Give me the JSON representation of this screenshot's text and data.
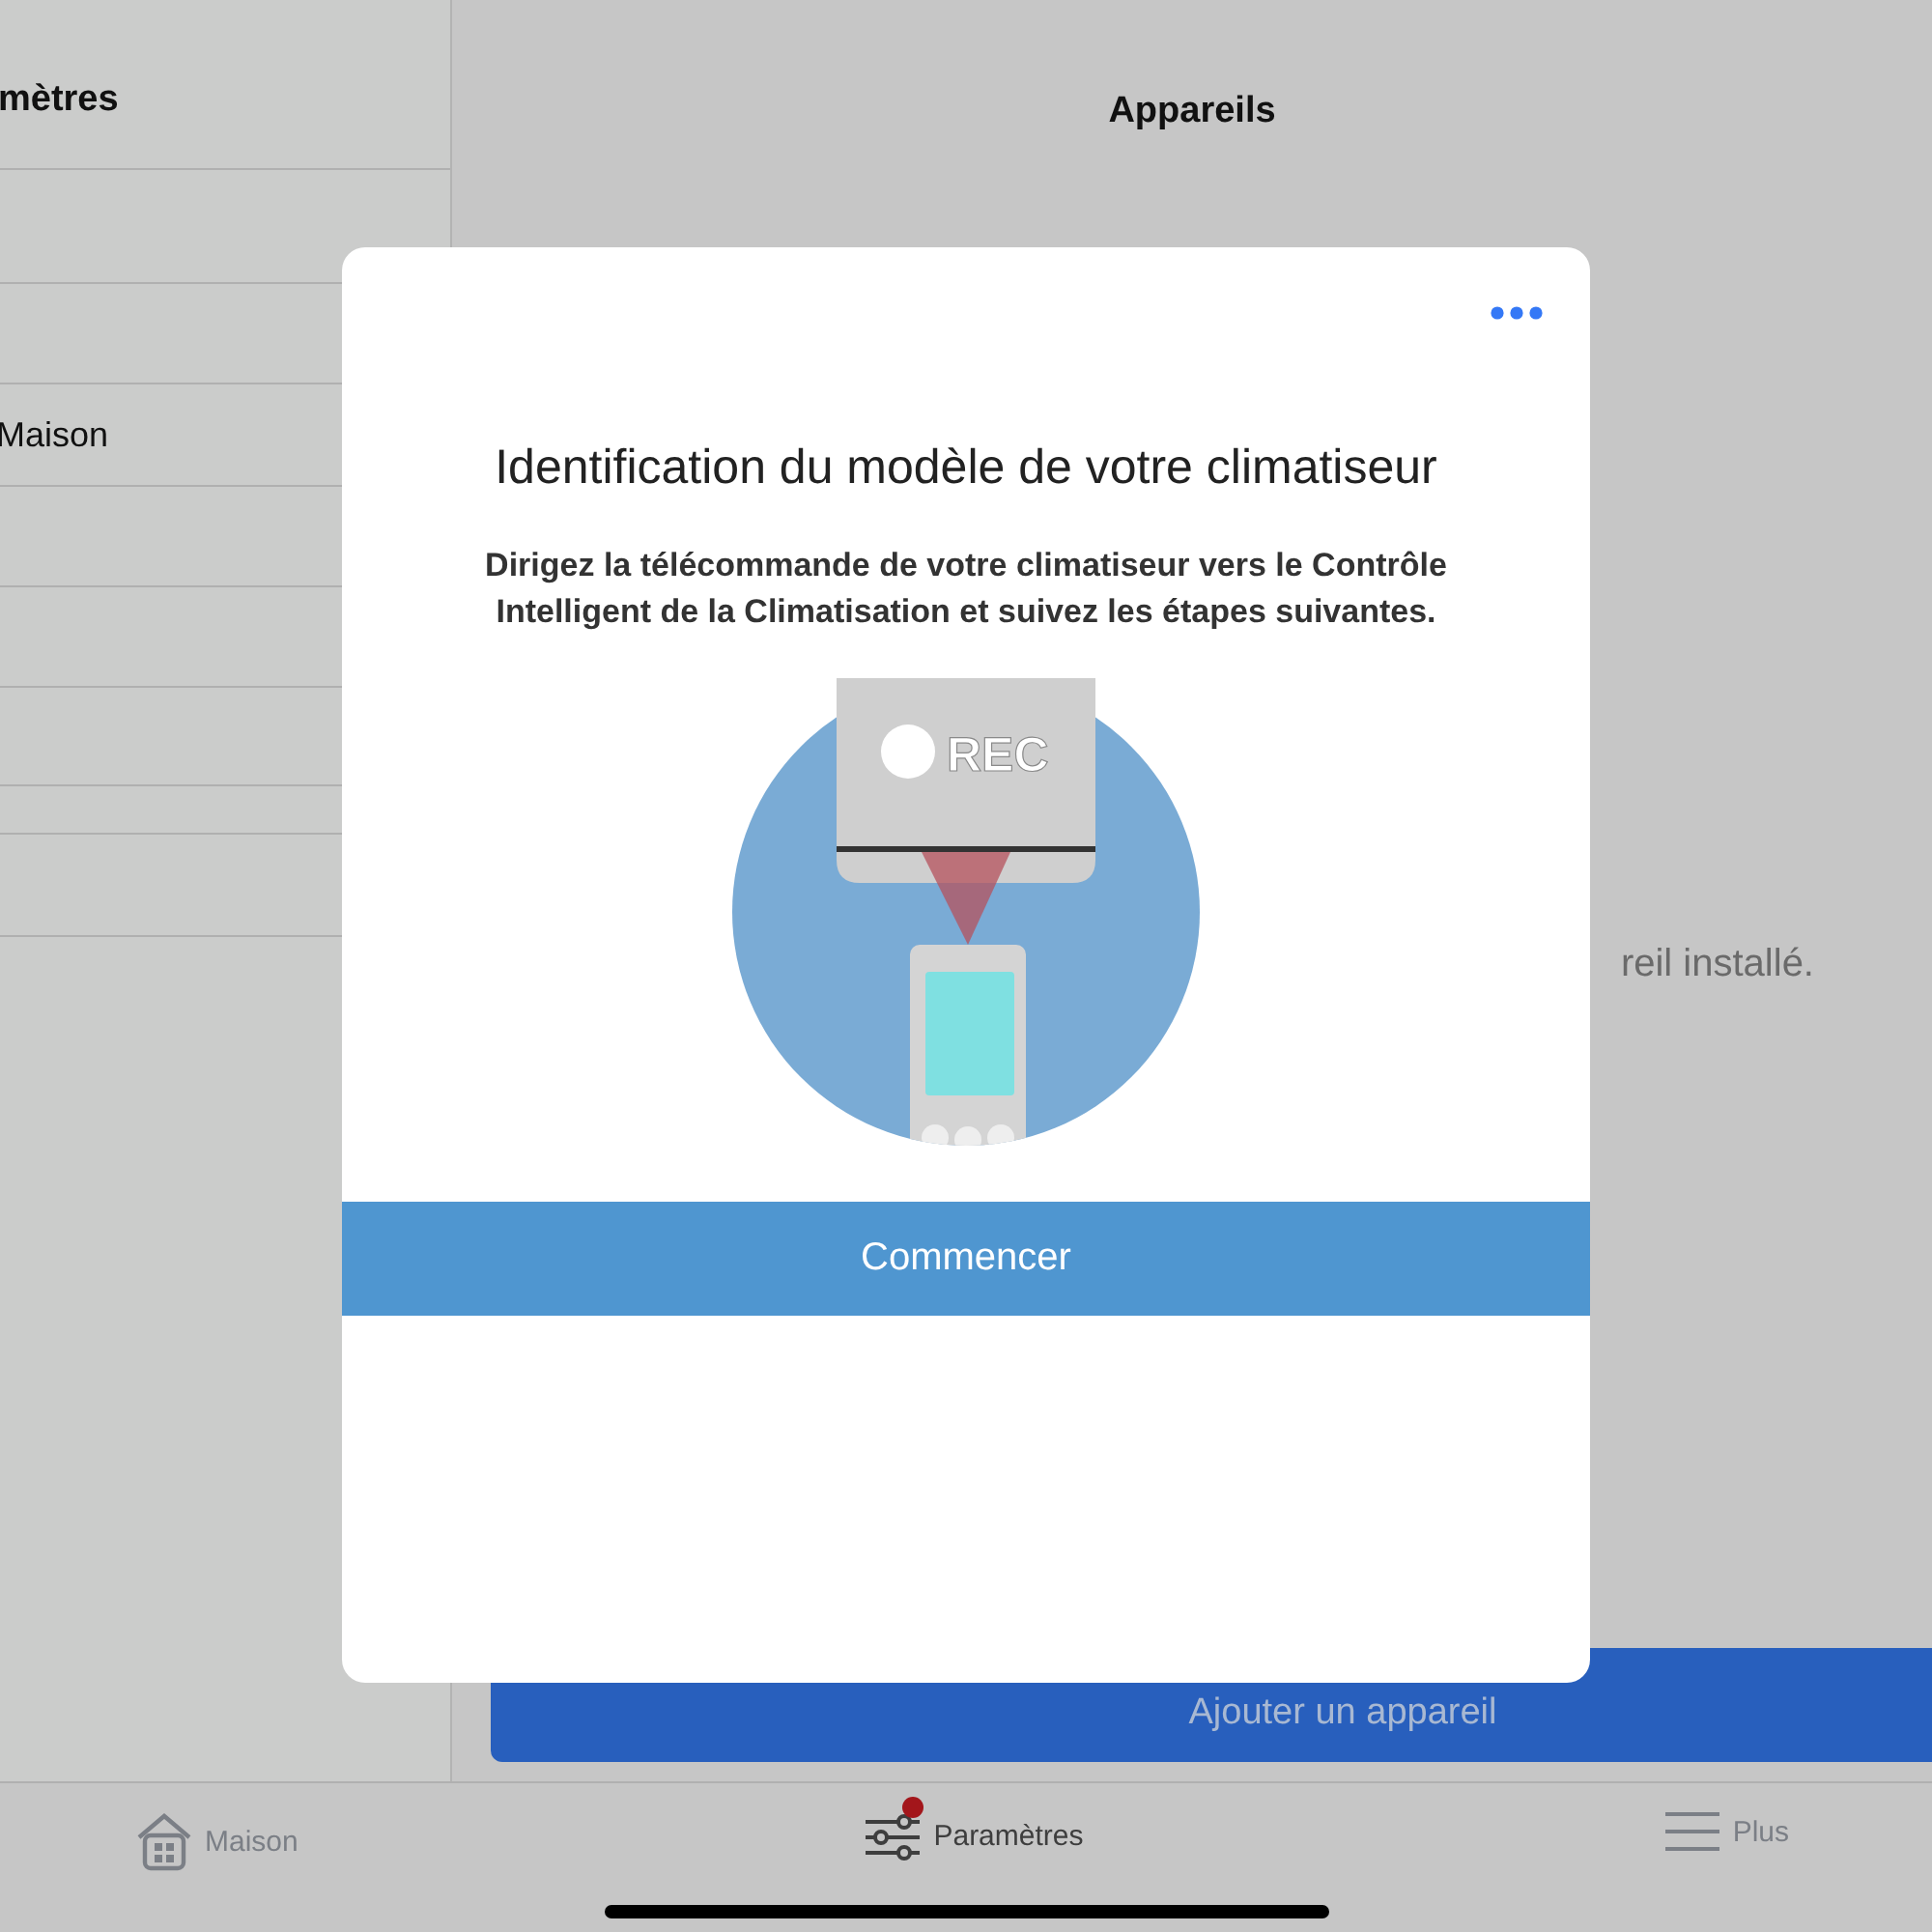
{
  "left_panel": {
    "title": "mètres",
    "items": [
      {
        "label": "Maison"
      }
    ]
  },
  "main_panel": {
    "title": "Appareils",
    "empty_message": "reil installé.",
    "add_button": "Ajouter un appareil"
  },
  "dialog": {
    "title": "Identification du modèle de votre climatiseur",
    "message": "Dirigez la télécommande de votre climatiseur vers le Contrôle Intelligent de la Climatisation et suivez les étapes suivantes.",
    "illustration_label": "REC",
    "start_button": "Commencer"
  },
  "tab_bar": [
    {
      "label": "Maison",
      "kind": "home",
      "selected": false,
      "badge": false
    },
    {
      "label": "Paramètres",
      "kind": "sliders",
      "selected": true,
      "badge": true
    },
    {
      "label": "Plus",
      "kind": "menu",
      "selected": false,
      "badge": false
    }
  ]
}
